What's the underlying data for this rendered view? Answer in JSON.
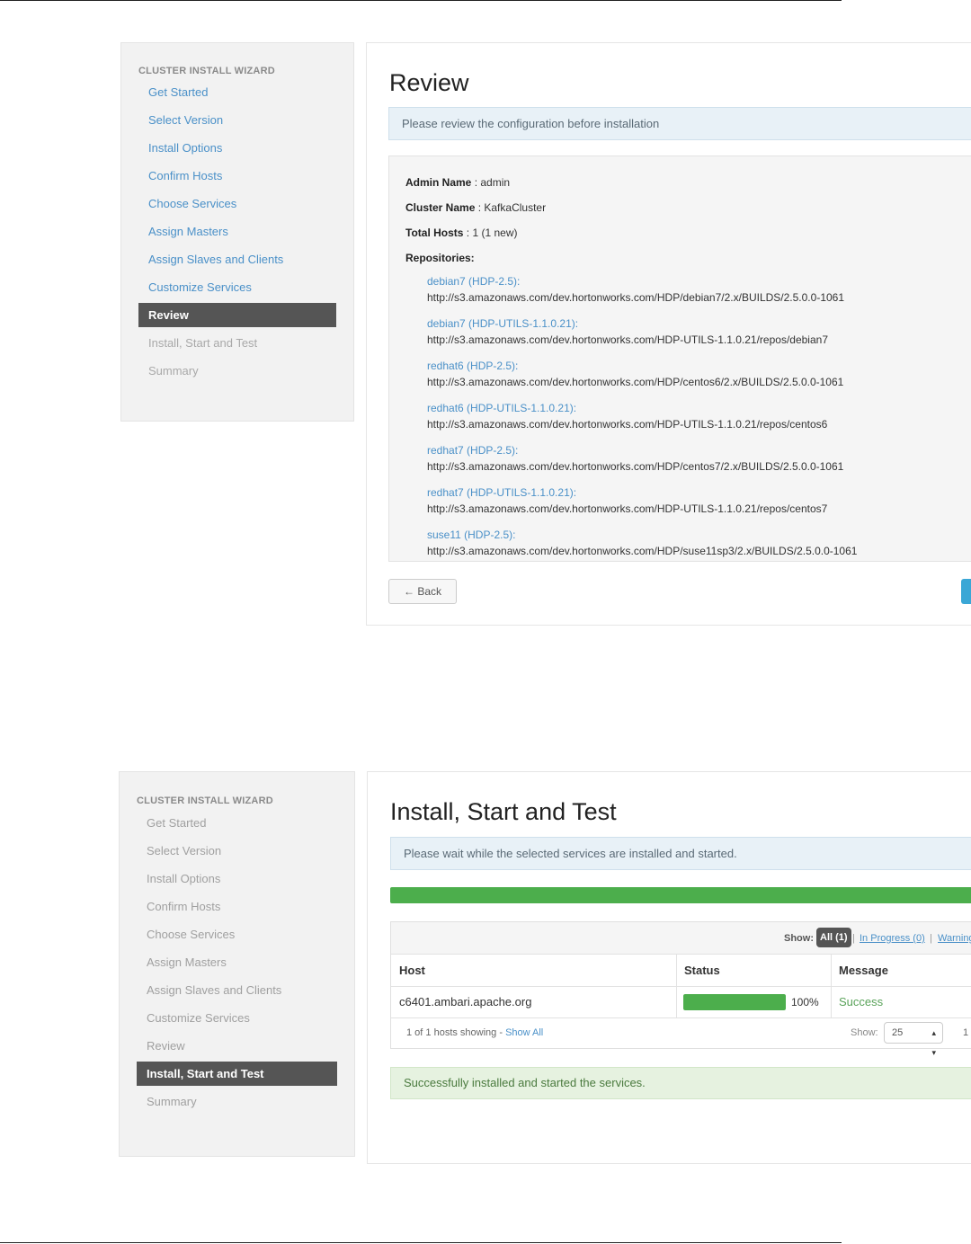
{
  "wizard_title": "CLUSTER INSTALL WIZARD",
  "steps": [
    "Get Started",
    "Select Version",
    "Install Options",
    "Confirm Hosts",
    "Choose Services",
    "Assign Masters",
    "Assign Slaves and Clients",
    "Customize Services",
    "Review",
    "Install, Start and Test",
    "Summary"
  ],
  "review": {
    "title": "Review",
    "info": "Please review the configuration before installation",
    "admin_label": "Admin Name",
    "admin_value": " : admin",
    "cluster_label": "Cluster Name",
    "cluster_value": " : KafkaCluster",
    "hosts_label": "Total Hosts",
    "hosts_value": " : 1 (1 new)",
    "repos_label": "Repositories:",
    "repositories": [
      {
        "name": "debian7 (HDP-2.5):",
        "url": "http://s3.amazonaws.com/dev.hortonworks.com/HDP/debian7/2.x/BUILDS/2.5.0.0-1061"
      },
      {
        "name": "debian7 (HDP-UTILS-1.1.0.21):",
        "url": "http://s3.amazonaws.com/dev.hortonworks.com/HDP-UTILS-1.1.0.21/repos/debian7"
      },
      {
        "name": "redhat6 (HDP-2.5):",
        "url": "http://s3.amazonaws.com/dev.hortonworks.com/HDP/centos6/2.x/BUILDS/2.5.0.0-1061"
      },
      {
        "name": "redhat6 (HDP-UTILS-1.1.0.21):",
        "url": "http://s3.amazonaws.com/dev.hortonworks.com/HDP-UTILS-1.1.0.21/repos/centos6"
      },
      {
        "name": "redhat7 (HDP-2.5):",
        "url": "http://s3.amazonaws.com/dev.hortonworks.com/HDP/centos7/2.x/BUILDS/2.5.0.0-1061"
      },
      {
        "name": "redhat7 (HDP-UTILS-1.1.0.21):",
        "url": "http://s3.amazonaws.com/dev.hortonworks.com/HDP-UTILS-1.1.0.21/repos/centos7"
      },
      {
        "name": "suse11 (HDP-2.5):",
        "url": "http://s3.amazonaws.com/dev.hortonworks.com/HDP/suse11sp3/2.x/BUILDS/2.5.0.0-1061"
      }
    ],
    "back_label": "← Back"
  },
  "install": {
    "title": "Install, Start and Test",
    "info": "Please wait while the selected services are installed and started.",
    "overall_progress": 1.0,
    "filter_show_label": "Show:",
    "filter_all": "All (1)",
    "filter_sep": "|",
    "filter_in_progress": "In Progress (0)",
    "filter_warning": "Warning",
    "columns": [
      "Host",
      "Status",
      "Message"
    ],
    "rows": [
      {
        "host": "c6401.ambari.apache.org",
        "progress": 1.0,
        "percent": "100%",
        "message": "Success"
      }
    ],
    "footer_count": "1 of 1 hosts showing - ",
    "footer_show_all": "Show All",
    "footer_show_label": "Show:",
    "page_size": "25",
    "page_number": "1",
    "success_message": "Successfully installed and started the services."
  },
  "colors": {
    "link": "#4a90c8",
    "active_step": "#555555",
    "progress": "#4cae4c",
    "primary_button": "#3aa7d6"
  }
}
